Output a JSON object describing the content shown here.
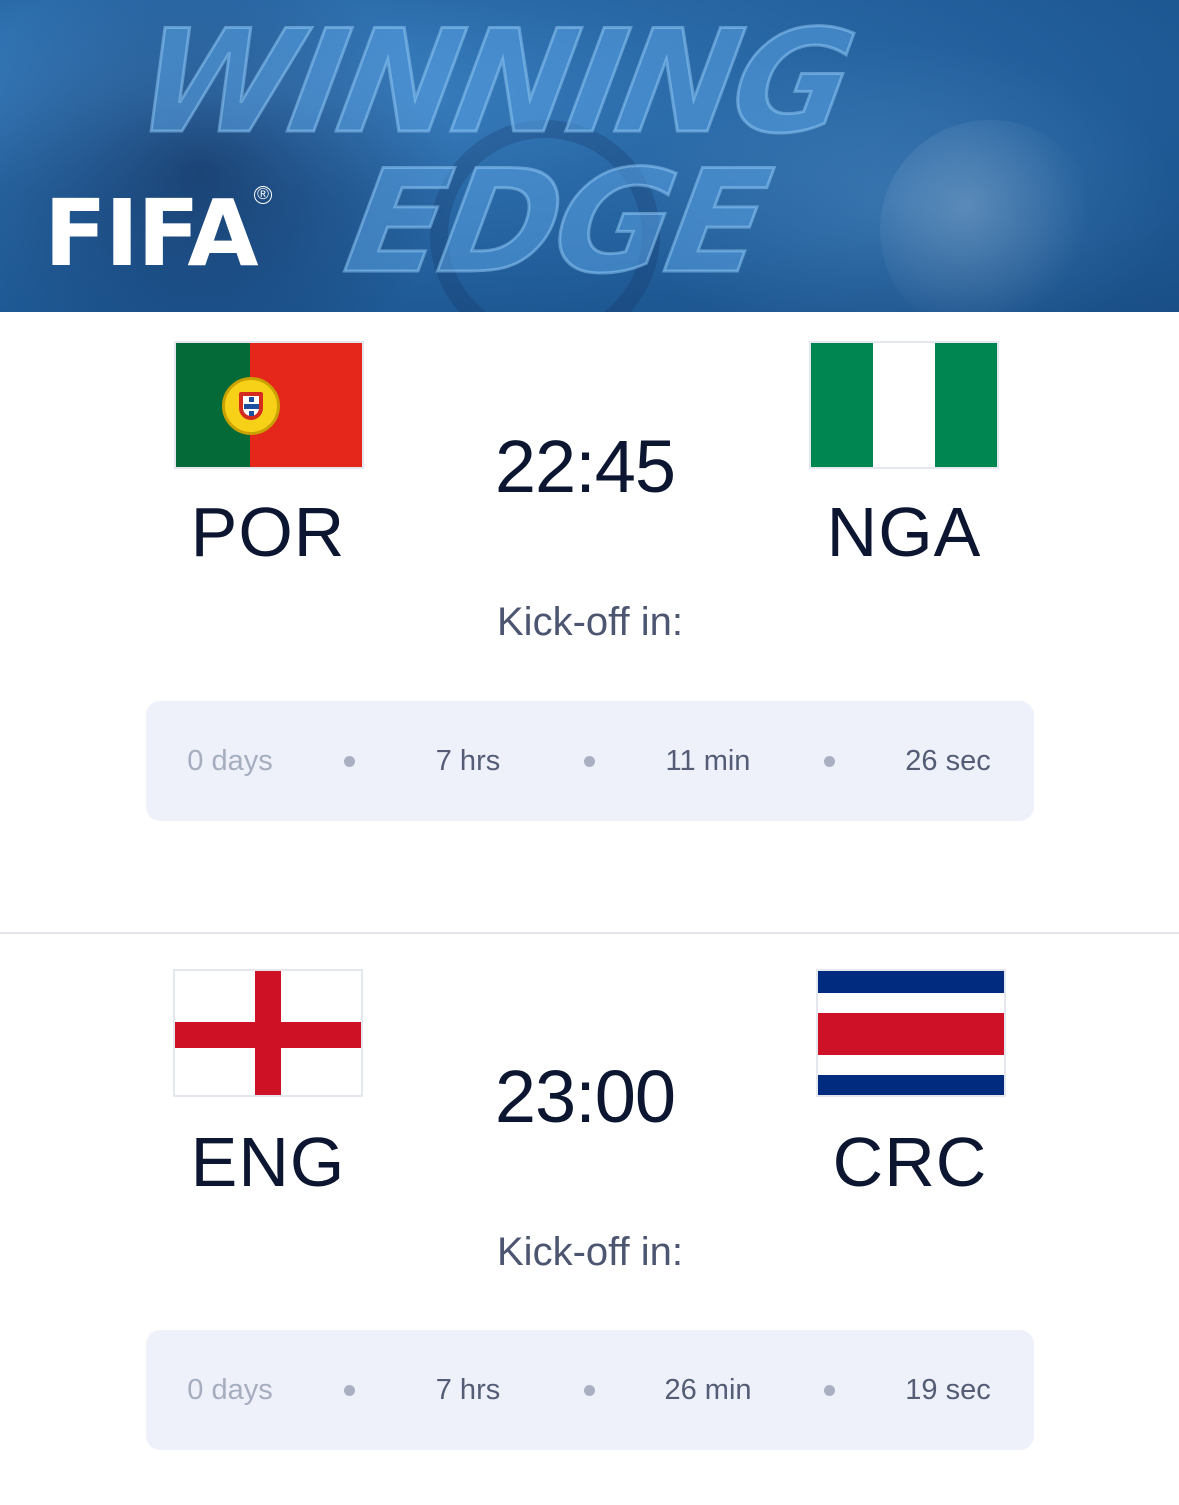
{
  "banner": {
    "brand": "FIFA",
    "registered": "®",
    "headline_line1": "WINNING",
    "headline_line2": "EDGE"
  },
  "matches": [
    {
      "home": {
        "code": "POR",
        "flag_icon": "portugal-flag-icon"
      },
      "away": {
        "code": "NGA",
        "flag_icon": "nigeria-flag-icon"
      },
      "kickoff_time": "22:45",
      "kickoff_label": "Kick-off in:",
      "countdown": {
        "days": "0 days",
        "hours": "7 hrs",
        "minutes": "11 min",
        "seconds": "26 sec"
      }
    },
    {
      "home": {
        "code": "ENG",
        "flag_icon": "england-flag-icon"
      },
      "away": {
        "code": "CRC",
        "flag_icon": "costa-rica-flag-icon"
      },
      "kickoff_time": "23:00",
      "kickoff_label": "Kick-off in:",
      "countdown": {
        "days": "0 days",
        "hours": "7 hrs",
        "minutes": "26 min",
        "seconds": "19 sec"
      }
    }
  ],
  "colors": {
    "banner_blue": "#1f5a96",
    "text_dark": "#0c1631",
    "countdown_bg": "#eef1fa",
    "portugal_green": "#046a38",
    "portugal_red": "#e5261a",
    "nigeria_green": "#008751",
    "england_red": "#ce1124",
    "costa_rica_blue": "#002b7f",
    "costa_rica_red": "#ce1126"
  }
}
